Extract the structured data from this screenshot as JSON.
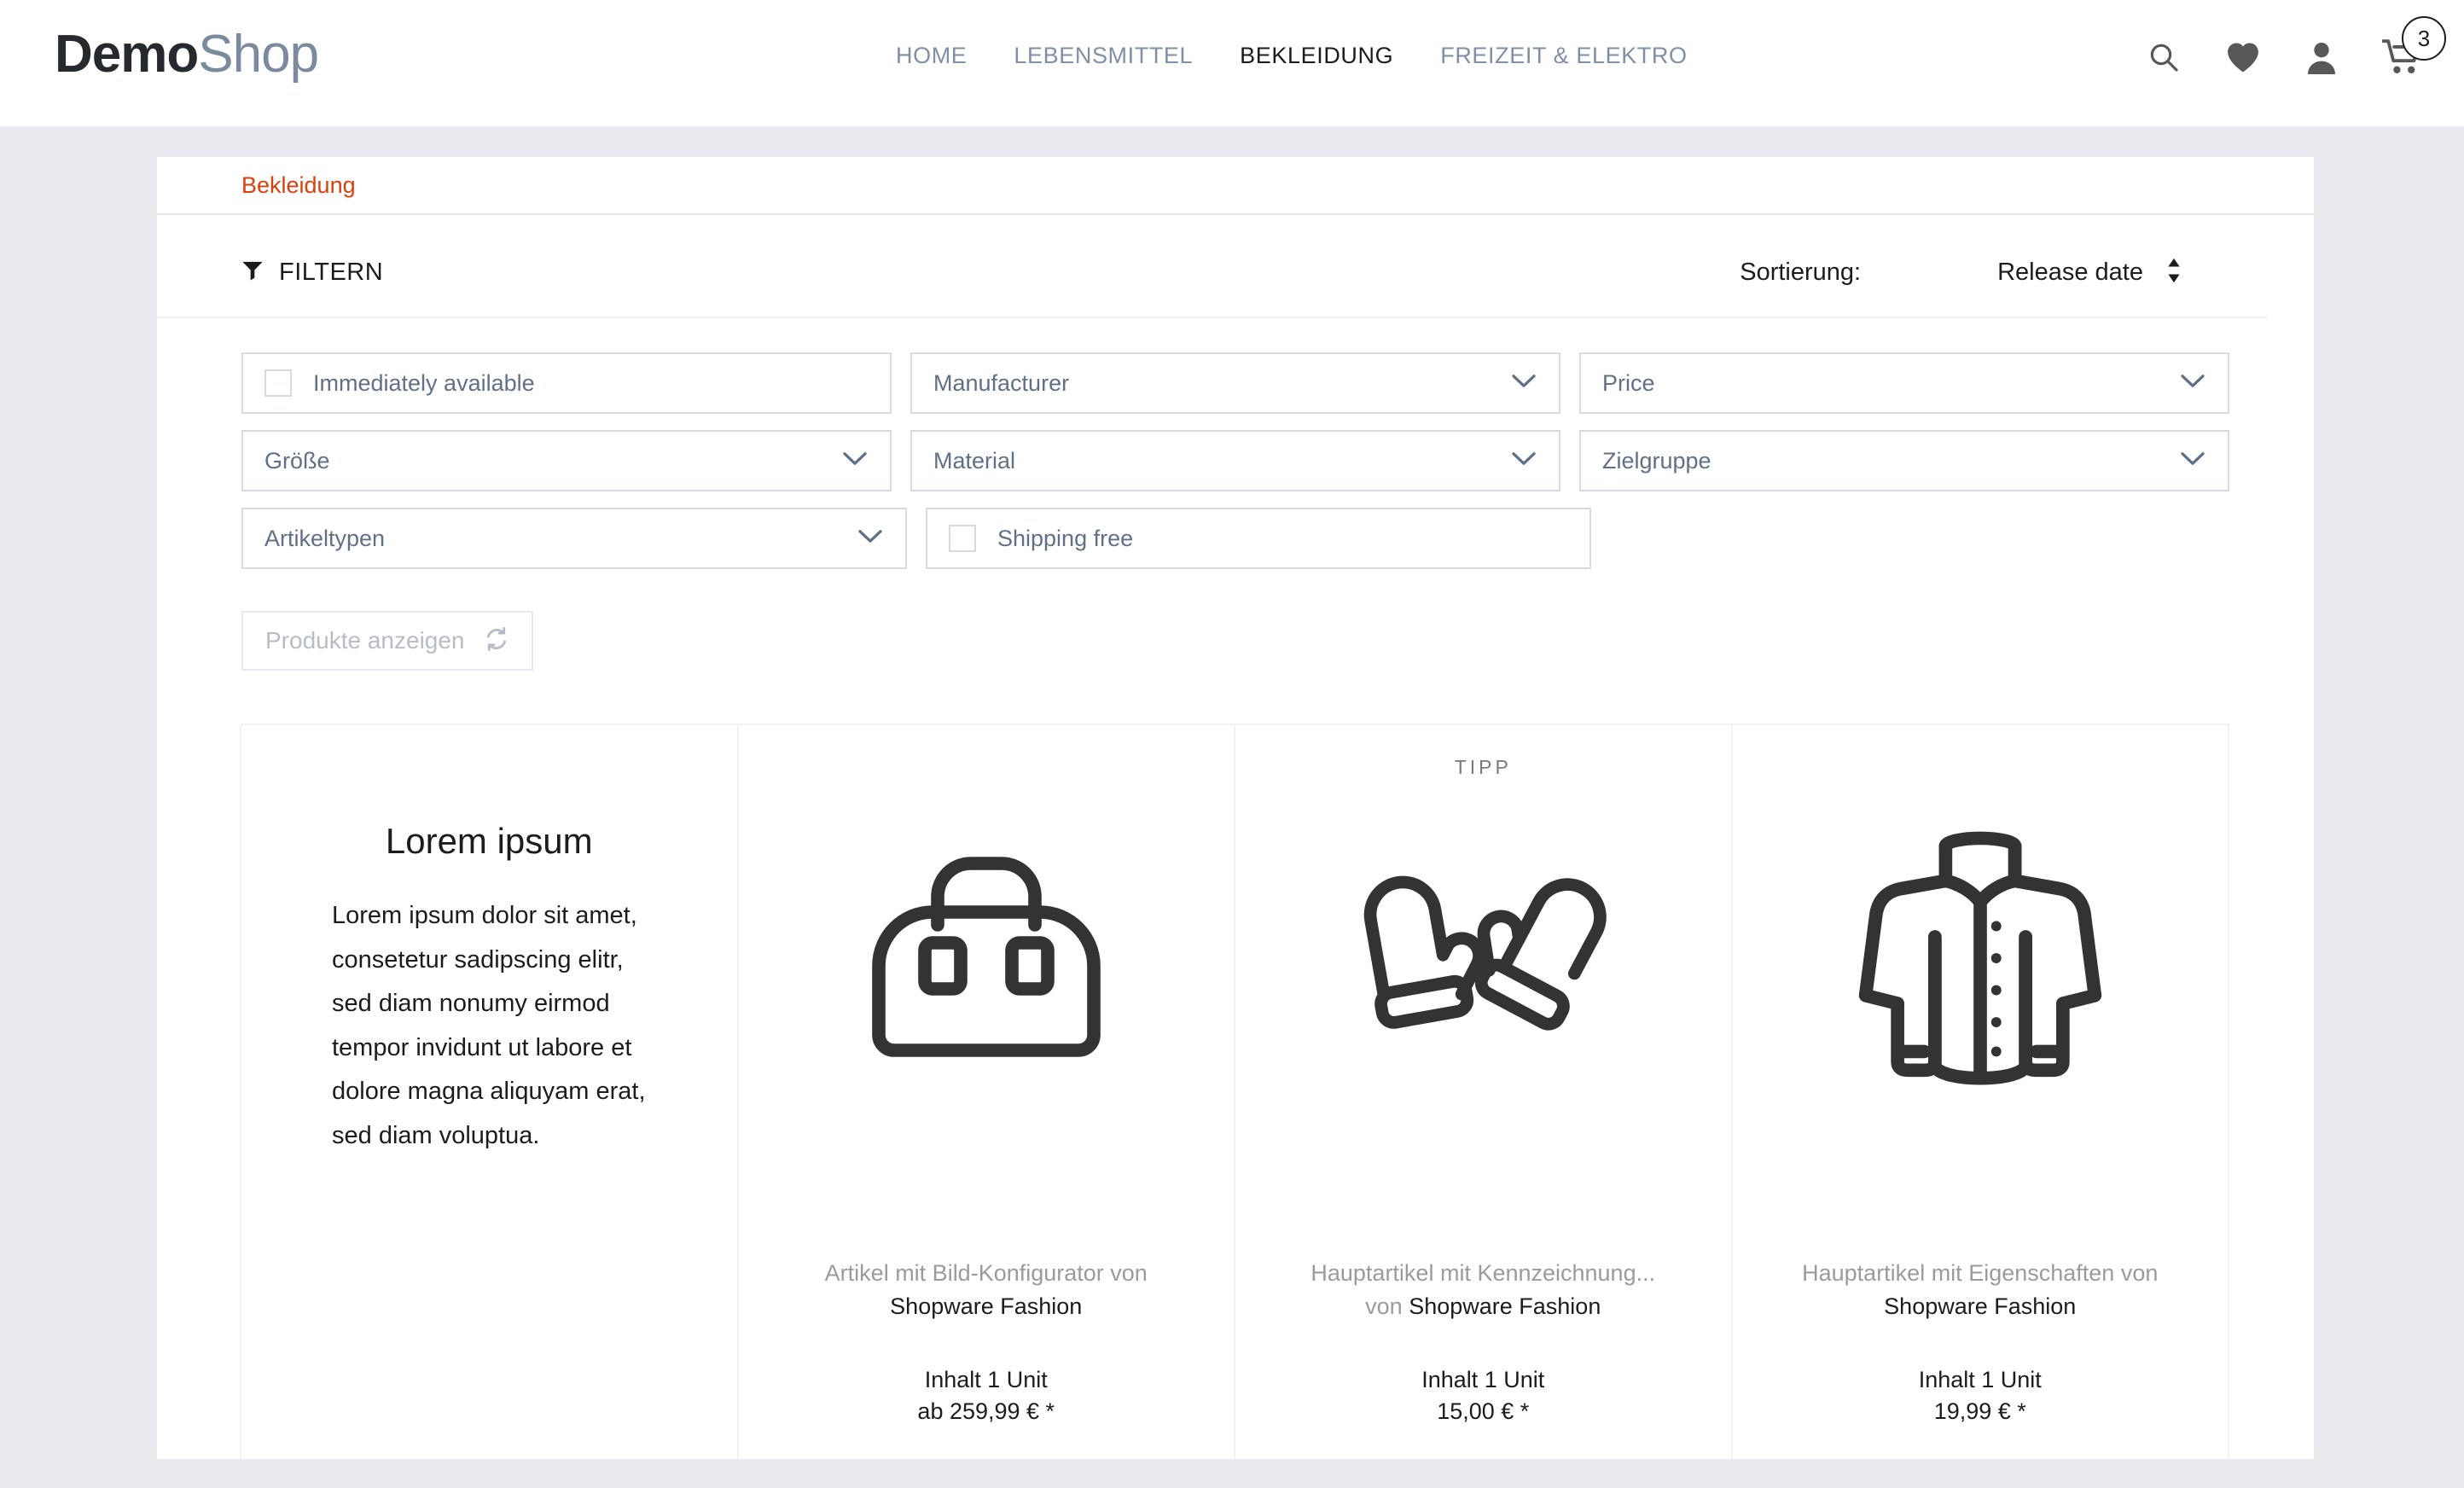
{
  "header": {
    "logo_primary": "Demo",
    "logo_secondary": "Shop",
    "nav": [
      {
        "label": "HOME",
        "active": false
      },
      {
        "label": "LEBENSMITTEL",
        "active": false
      },
      {
        "label": "BEKLEIDUNG",
        "active": true
      },
      {
        "label": "FREIZEIT & ELEKTRO",
        "active": false
      }
    ],
    "icons": [
      "search-icon",
      "heart-icon",
      "account-icon",
      "cart-icon"
    ],
    "cart_count": "3"
  },
  "breadcrumb": {
    "current": "Bekleidung"
  },
  "listing": {
    "filter_toggle_label": "FILTERN",
    "sorting_label": "Sortierung:",
    "sorting_value": "Release date",
    "apply_button_label": "Produkte anzeigen",
    "filters": [
      {
        "type": "checkbox",
        "label": "Immediately available",
        "checked": false
      },
      {
        "type": "select",
        "label": "Manufacturer"
      },
      {
        "type": "select",
        "label": "Price"
      },
      {
        "type": "select",
        "label": "Größe"
      },
      {
        "type": "select",
        "label": "Material"
      },
      {
        "type": "select",
        "label": "Zielgruppe"
      },
      {
        "type": "select",
        "label": "Artikeltypen"
      },
      {
        "type": "checkbox",
        "label": "Shipping free",
        "checked": false
      }
    ]
  },
  "text_card": {
    "title": "Lorem ipsum",
    "body": "Lorem ipsum dolor sit amet, consetetur sadipscing elitr, sed diam nonumy eirmod tempor invidunt ut labore et dolore magna aliquyam erat, sed diam voluptua."
  },
  "products": [
    {
      "badge": "",
      "icon": "duffle-bag-icon",
      "name_prefix": "Artikel mit Bild-Konfigurator von",
      "manufacturer_prefix": "",
      "manufacturer": "Shopware Fashion",
      "content": "Inhalt 1 Unit",
      "price": "ab 259,99 € *"
    },
    {
      "badge": "TIPP",
      "icon": "mittens-icon",
      "name_prefix": "Hauptartikel mit Kennzeichnung...",
      "manufacturer_prefix": "von ",
      "manufacturer": "Shopware Fashion",
      "content": "Inhalt 1 Unit",
      "price": "15,00 € *"
    },
    {
      "badge": "",
      "icon": "jacket-icon",
      "name_prefix": "Hauptartikel mit Eigenschaften von",
      "manufacturer_prefix": "",
      "manufacturer": "Shopware Fashion",
      "content": "Inhalt 1 Unit",
      "price": "19,99 € *"
    }
  ],
  "colors": {
    "accent": "#d9400b",
    "nav_inactive": "#7f90a6",
    "logo_secondary": "#7c8a9e",
    "page_background": "#e8eaef",
    "border": "#d6dae3"
  }
}
